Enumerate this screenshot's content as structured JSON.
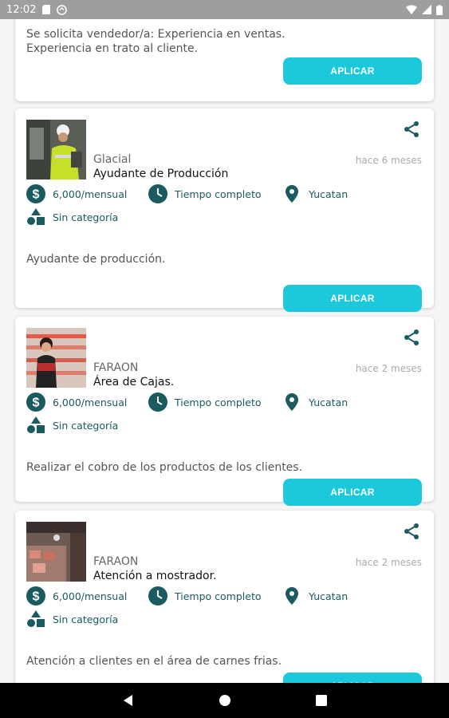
{
  "status_bar": {
    "time": "12:02",
    "icons": [
      "sd-card-icon",
      "sync-icon",
      "wifi-icon",
      "signal-icon",
      "battery-icon"
    ]
  },
  "colors": {
    "accent": "#1cc8dc",
    "icon_dark": "#1a5a60",
    "status_bar": "#9e9e9e",
    "nav_bar": "#000000"
  },
  "partial_card": {
    "description": "Se solicita vendedor/a: Experiencia en ventas. Experiencia en trato al cliente.",
    "apply_label": "APLICAR"
  },
  "jobs": [
    {
      "company": "Glacial",
      "title": "Ayudante de Producción",
      "posted": "hace 6 meses",
      "salary": "6,000/mensual",
      "schedule": "Tiempo completo",
      "location": "Yucatan",
      "category": "Sin categoría",
      "description": "Ayudante de producción.",
      "apply_label": "APLICAR"
    },
    {
      "company": "FARAON",
      "title": "Área de Cajas.",
      "posted": "hace 2 meses",
      "salary": "6,000/mensual",
      "schedule": "Tiempo completo",
      "location": "Yucatan",
      "category": "Sin categoría",
      "description": "Realizar el cobro de los productos de los clientes.",
      "apply_label": "APLICAR"
    },
    {
      "company": "FARAON",
      "title": "Atención a mostrador.",
      "posted": "hace 2 meses",
      "salary": "6,000/mensual",
      "schedule": "Tiempo completo",
      "location": "Yucatan",
      "category": "Sin categoría",
      "description": "Atención a clientes en el área de carnes frias.",
      "apply_label": "APLICAR"
    }
  ],
  "nav": {
    "icons": [
      "back-icon",
      "home-icon",
      "recents-icon"
    ]
  }
}
